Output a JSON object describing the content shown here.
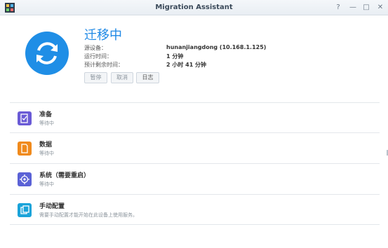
{
  "window": {
    "title": "Migration Assistant",
    "controls": {
      "help": "?",
      "minimize": "—",
      "maximize": "□",
      "close": "✕"
    }
  },
  "status": {
    "title": "迁移中",
    "rows": [
      {
        "label": "源设备：",
        "value": "hunanjiangdong (10.168.1.125)"
      },
      {
        "label": "运行时间：",
        "value": "1 分钟"
      },
      {
        "label": "预计剩余时间：",
        "value": "2 小时 41 分钟"
      }
    ],
    "buttons": {
      "pause": "暂停",
      "cancel": "取消",
      "log": "日志"
    }
  },
  "steps": [
    {
      "name": "准备",
      "sub": "等待中",
      "color": "#6a5bd6",
      "icon": "document-check-icon"
    },
    {
      "name": "数据",
      "sub": "等待中",
      "color": "#f08a1c",
      "icon": "file-icon"
    },
    {
      "name": "系统（需要重启）",
      "sub": "等待中",
      "color": "#5b62d6",
      "icon": "gear-icon"
    },
    {
      "name": "手动配置",
      "sub": "需要手动配置才能开始在此设备上使用服务。",
      "color": "#1aa3d9",
      "icon": "copy-icon"
    }
  ]
}
